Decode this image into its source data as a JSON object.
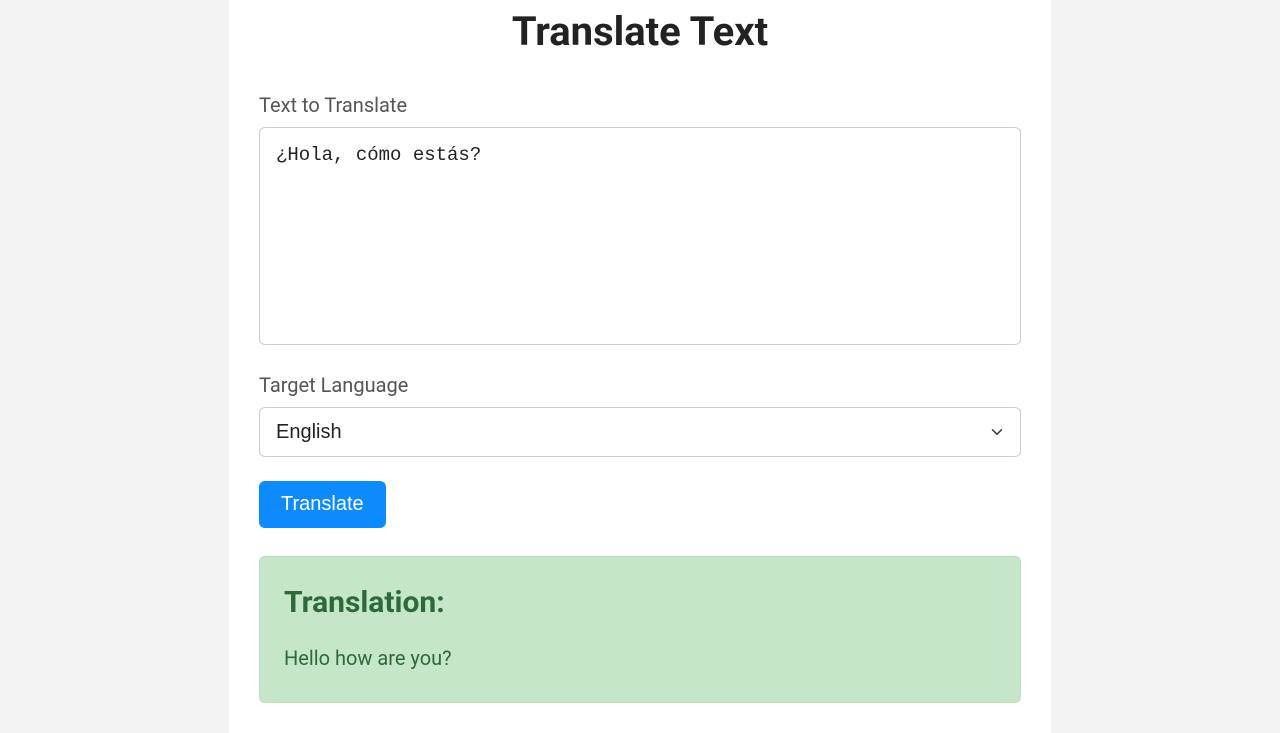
{
  "page": {
    "title": "Translate Text"
  },
  "form": {
    "text_label": "Text to Translate",
    "text_value": "¿Hola, cómo estás?",
    "language_label": "Target Language",
    "language_selected": "English",
    "translate_button_label": "Translate"
  },
  "result": {
    "heading": "Translation:",
    "text": "Hello how are you?"
  }
}
